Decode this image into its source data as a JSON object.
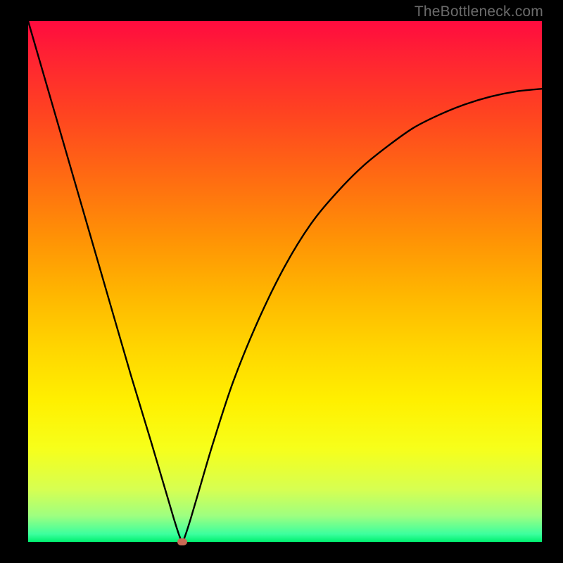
{
  "watermark": "TheBottleneck.com",
  "marker_color": "#c96a55",
  "chart_data": {
    "type": "line",
    "title": "",
    "xlabel": "",
    "ylabel": "",
    "xlim": [
      0,
      100
    ],
    "ylim": [
      0,
      100
    ],
    "series": [
      {
        "name": "curve",
        "x": [
          0,
          5,
          10,
          15,
          20,
          24,
          27,
          28.5,
          29.5,
          30,
          30.5,
          31.5,
          33,
          36,
          40,
          45,
          50,
          55,
          60,
          65,
          70,
          75,
          80,
          85,
          90,
          95,
          100
        ],
        "values": [
          100,
          83,
          66,
          49,
          32,
          19,
          9,
          4,
          1,
          0,
          1,
          4,
          9,
          19,
          31,
          43,
          53,
          61,
          67,
          72,
          76,
          79.5,
          82,
          84,
          85.5,
          86.5,
          87
        ]
      }
    ],
    "minimum_point": {
      "x": 30,
      "y": 0
    }
  }
}
